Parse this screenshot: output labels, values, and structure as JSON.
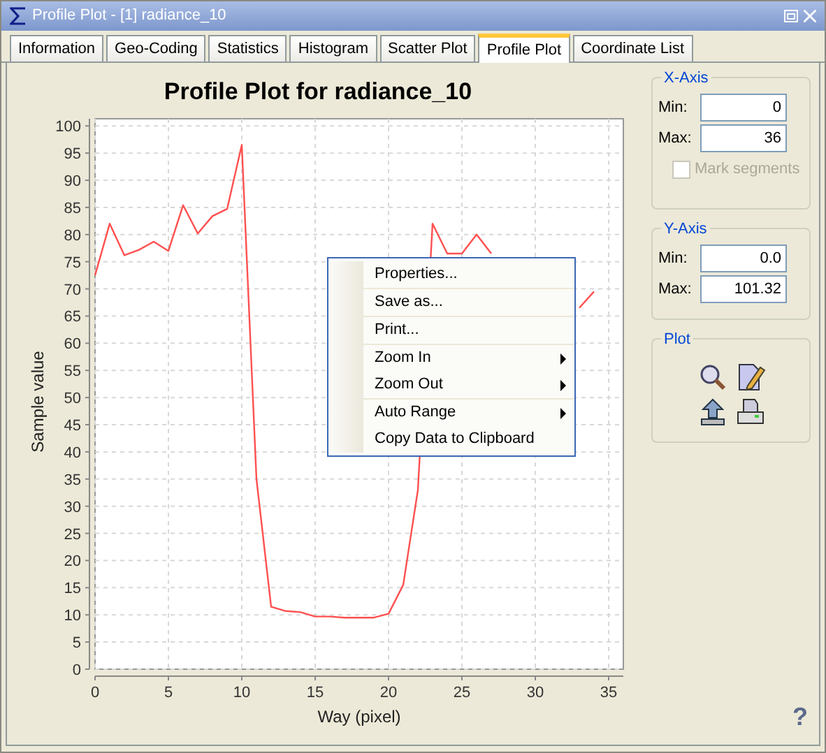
{
  "window": {
    "title": "Profile Plot - [1] radiance_10"
  },
  "tabs": [
    {
      "label": "Information",
      "selected": false
    },
    {
      "label": "Geo-Coding",
      "selected": false
    },
    {
      "label": "Statistics",
      "selected": false
    },
    {
      "label": "Histogram",
      "selected": false
    },
    {
      "label": "Scatter Plot",
      "selected": false
    },
    {
      "label": "Profile Plot",
      "selected": true
    },
    {
      "label": "Coordinate List",
      "selected": false
    }
  ],
  "chart_data": {
    "type": "line",
    "title": "Profile Plot for radiance_10",
    "xlabel": "Way (pixel)",
    "ylabel": "Sample value",
    "xlim": [
      0,
      36
    ],
    "ylim": [
      0,
      101.32
    ],
    "xticks": [
      0,
      5,
      10,
      15,
      20,
      25,
      30,
      35
    ],
    "yticks": [
      0,
      5,
      10,
      15,
      20,
      25,
      30,
      35,
      40,
      45,
      50,
      55,
      60,
      65,
      70,
      75,
      80,
      85,
      90,
      95,
      100
    ],
    "x": [
      0,
      1,
      2,
      3,
      4,
      5,
      6,
      7,
      8,
      9,
      10,
      11,
      12,
      13,
      14,
      15,
      16,
      17,
      18,
      19,
      20,
      21,
      22,
      23,
      24,
      25,
      26,
      27,
      28,
      29,
      30,
      31,
      32,
      33,
      34
    ],
    "grid": true,
    "series": [
      {
        "color": "#ff5050",
        "values": [
          72.5,
          82,
          76.2,
          77.2,
          78.7,
          77,
          85.4,
          80.2,
          83.4,
          84.7,
          96.5,
          35,
          11.5,
          10.7,
          10.5,
          9.7,
          9.7,
          9.5,
          9.5,
          9.5,
          10.2,
          15.5,
          33,
          82,
          76.5,
          76.5,
          80,
          76.5,
          null,
          null,
          null,
          null,
          null,
          66.5,
          69.5
        ]
      }
    ]
  },
  "context_menu": {
    "groups": [
      [
        {
          "label": "Properties...",
          "submenu": false
        }
      ],
      [
        {
          "label": "Save as...",
          "submenu": false
        }
      ],
      [
        {
          "label": "Print...",
          "submenu": false
        }
      ],
      [
        {
          "label": "Zoom In",
          "submenu": true
        },
        {
          "label": "Zoom Out",
          "submenu": true
        }
      ],
      [
        {
          "label": "Auto Range",
          "submenu": true
        },
        {
          "label": "Copy Data to Clipboard",
          "submenu": false
        }
      ]
    ]
  },
  "x_axis": {
    "title": "X-Axis",
    "min_label": "Min:",
    "min": "0",
    "max_label": "Max:",
    "max": "36",
    "mark_segments": {
      "label": "Mark segments",
      "checked": false,
      "disabled": true
    }
  },
  "y_axis": {
    "title": "Y-Axis",
    "min_label": "Min:",
    "min": "0.0",
    "max_label": "Max:",
    "max": "101.32"
  },
  "plot": {
    "title": "Plot"
  },
  "help": {
    "label": "?"
  }
}
